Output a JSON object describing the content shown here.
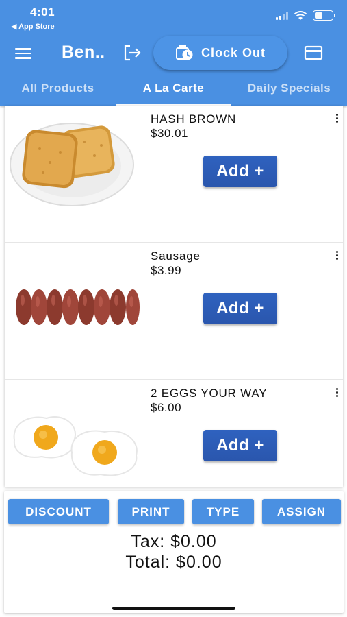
{
  "status_bar": {
    "time": "4:01",
    "back_label": "◀ App Store"
  },
  "header": {
    "user_name": "Ben..",
    "clock_out_label": "Clock Out",
    "tabs": [
      {
        "label": "All Products"
      },
      {
        "label": "A La Carte"
      },
      {
        "label": "Daily Specials"
      }
    ],
    "active_tab": "A La Carte"
  },
  "products": [
    {
      "name": "HASH BROWN",
      "price": "$30.01",
      "add_label": "Add +"
    },
    {
      "name": "Sausage",
      "price": "$3.99",
      "add_label": "Add +"
    },
    {
      "name": "2 EGGS YOUR WAY",
      "price": "$6.00",
      "add_label": "Add +"
    }
  ],
  "actions": {
    "discount": "DISCOUNT",
    "print": "PRINT",
    "type": "TYPE",
    "assign": "ASSIGN"
  },
  "totals": {
    "tax": "Tax: $0.00",
    "total": "Total: $0.00"
  },
  "colors": {
    "primary": "#4a90e2",
    "add_button": "#2f62bf"
  },
  "icons": [
    "menu-icon",
    "logout-icon",
    "clock-icon",
    "credit-card-icon",
    "more-vert-icon",
    "signal-icon",
    "wifi-icon",
    "battery-icon"
  ]
}
